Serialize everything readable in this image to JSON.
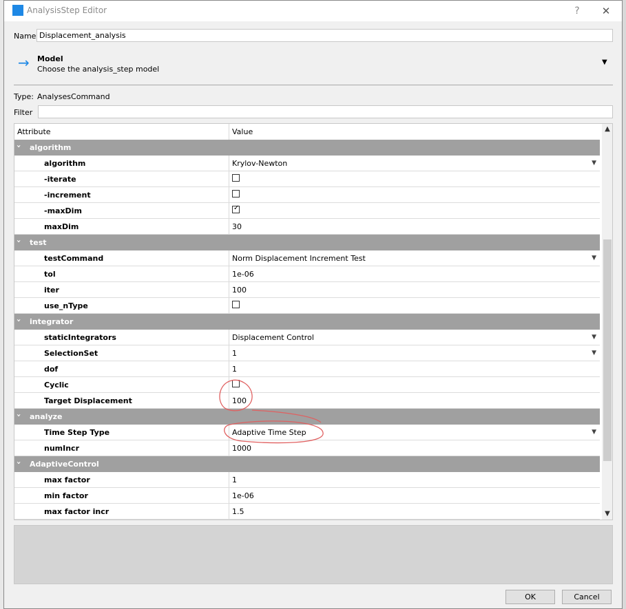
{
  "window": {
    "title": "AnalysisStep Editor",
    "help_glyph": "?",
    "close_glyph": "✕"
  },
  "name_field": {
    "label": "Name",
    "value": "Displacement_analysis"
  },
  "model_section": {
    "arrow_glyph": "→",
    "title": "Model",
    "subtitle": "Choose the analysis_step model",
    "dropdown_glyph": "▼"
  },
  "type_line": {
    "label": "Type:",
    "value": "AnalysesCommand"
  },
  "filter": {
    "label": "Filter",
    "value": ""
  },
  "table": {
    "columns": [
      "Attribute",
      "Value"
    ],
    "groups": [
      {
        "name": "algorithm",
        "rows": [
          {
            "attr": "algorithm",
            "kind": "dropdown",
            "value": "Krylov-Newton"
          },
          {
            "attr": "-iterate",
            "kind": "checkbox",
            "checked": false
          },
          {
            "attr": "-increment",
            "kind": "checkbox",
            "checked": false
          },
          {
            "attr": "-maxDim",
            "kind": "checkbox",
            "checked": true
          },
          {
            "attr": "maxDim",
            "kind": "text",
            "value": "30"
          }
        ]
      },
      {
        "name": "test",
        "rows": [
          {
            "attr": "testCommand",
            "kind": "dropdown",
            "value": "Norm Displacement Increment Test"
          },
          {
            "attr": "tol",
            "kind": "text",
            "value": "1e-06"
          },
          {
            "attr": "iter",
            "kind": "text",
            "value": "100"
          },
          {
            "attr": "use_nType",
            "kind": "checkbox",
            "checked": false
          }
        ]
      },
      {
        "name": "integrator",
        "rows": [
          {
            "attr": "staticIntegrators",
            "kind": "dropdown",
            "value": "Displacement Control"
          },
          {
            "attr": "SelectionSet",
            "kind": "dropdown",
            "value": "1"
          },
          {
            "attr": "dof",
            "kind": "text",
            "value": "1"
          },
          {
            "attr": "Cyclic",
            "kind": "checkbox",
            "checked": false
          },
          {
            "attr": "Target Displacement",
            "kind": "text",
            "value": "100"
          }
        ]
      },
      {
        "name": "analyze",
        "rows": [
          {
            "attr": "Time Step Type",
            "kind": "dropdown",
            "value": "Adaptive Time Step"
          },
          {
            "attr": "numIncr",
            "kind": "text",
            "value": "1000"
          }
        ]
      },
      {
        "name": "AdaptiveControl",
        "rows": [
          {
            "attr": "max factor",
            "kind": "text",
            "value": "1"
          },
          {
            "attr": "min factor",
            "kind": "text",
            "value": "1e-06"
          },
          {
            "attr": "max factor incr",
            "kind": "text",
            "value": "1.5"
          }
        ]
      }
    ]
  },
  "buttons": {
    "ok": "OK",
    "cancel": "Cancel"
  },
  "colors": {
    "group_header": "#a0a0a0",
    "accent": "#1e88e5",
    "annotation": "#e06060"
  }
}
